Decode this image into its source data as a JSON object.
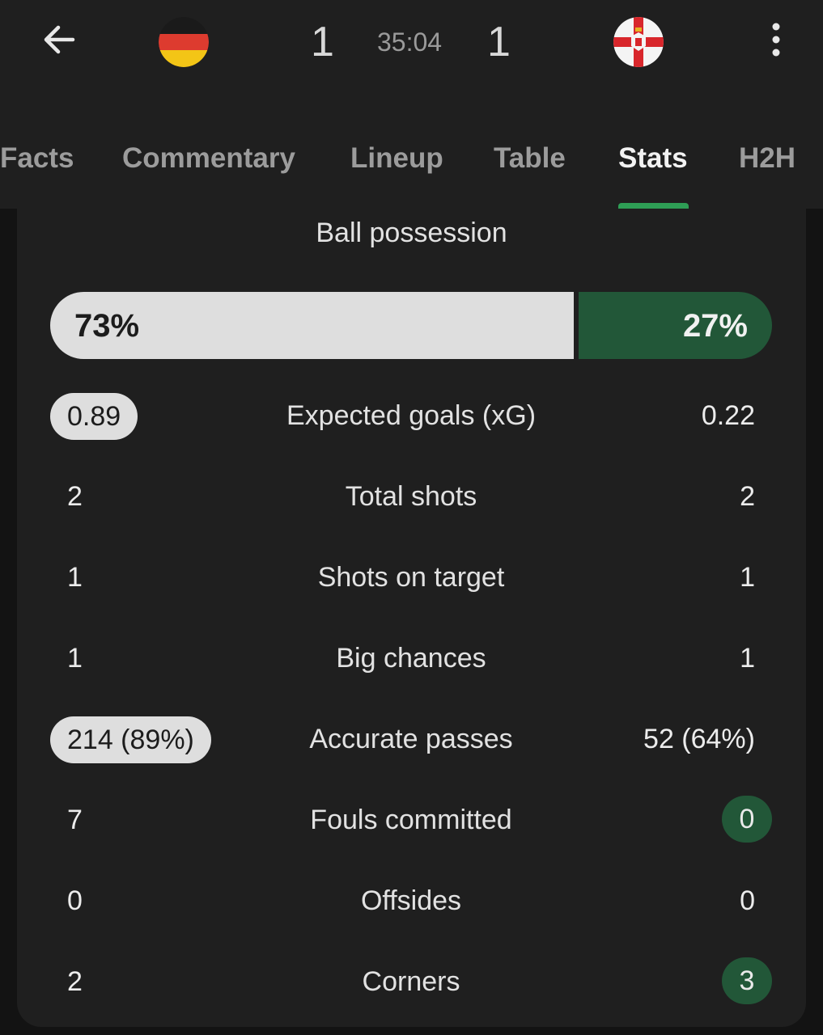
{
  "header": {
    "home_score": "1",
    "away_score": "1",
    "clock": "35:04",
    "home_flag": "germany-flag",
    "away_flag": "northern-ireland-flag"
  },
  "tabs": [
    "Facts",
    "Commentary",
    "Lineup",
    "Table",
    "Stats",
    "H2H"
  ],
  "active_tab": "Stats",
  "colors": {
    "accent_green": "#2e9e55",
    "away_highlight": "#225738",
    "home_highlight": "#dedede"
  },
  "possession": {
    "title": "Ball possession",
    "home_label": "73%",
    "away_label": "27%",
    "home_pct": 73,
    "away_pct": 27
  },
  "stats": [
    {
      "label": "Expected goals (xG)",
      "home": "0.89",
      "away": "0.22",
      "highlight": "home"
    },
    {
      "label": "Total shots",
      "home": "2",
      "away": "2",
      "highlight": "none"
    },
    {
      "label": "Shots on target",
      "home": "1",
      "away": "1",
      "highlight": "none"
    },
    {
      "label": "Big chances",
      "home": "1",
      "away": "1",
      "highlight": "none"
    },
    {
      "label": "Accurate passes",
      "home": "214 (89%)",
      "away": "52 (64%)",
      "highlight": "home"
    },
    {
      "label": "Fouls committed",
      "home": "7",
      "away": "0",
      "highlight": "away"
    },
    {
      "label": "Offsides",
      "home": "0",
      "away": "0",
      "highlight": "none"
    },
    {
      "label": "Corners",
      "home": "2",
      "away": "3",
      "highlight": "away"
    }
  ]
}
